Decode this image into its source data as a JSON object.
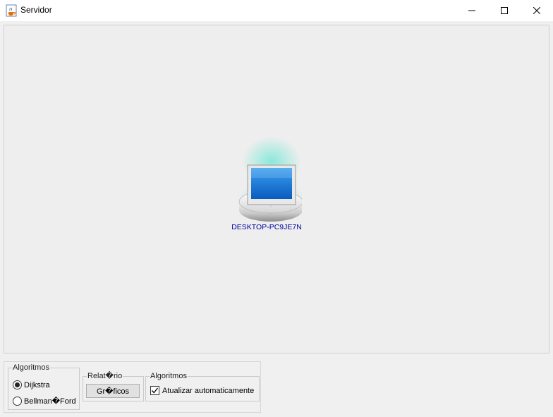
{
  "window": {
    "title": "Servidor",
    "icons": {
      "app": "java-cup-icon",
      "minimize": "minimize-icon",
      "maximize": "maximize-icon",
      "close": "close-icon"
    }
  },
  "canvas": {
    "node": {
      "label": "DESKTOP-PC9JE7N",
      "icon": "computer-server-icon",
      "label_color": "#0000a0"
    }
  },
  "controls": {
    "algoritmos_group": {
      "legend": "Algoritmos",
      "options": [
        {
          "label": "Dijkstra",
          "selected": true
        },
        {
          "label": "Bellman�Ford",
          "selected": false
        }
      ]
    },
    "relatorio_group": {
      "legend": "Relat�rio",
      "button_label": "Gr�ficos"
    },
    "algoritmos2_group": {
      "legend": "Algoritmos",
      "checkbox": {
        "label": "Atualizar automaticamente",
        "checked": true
      }
    }
  }
}
